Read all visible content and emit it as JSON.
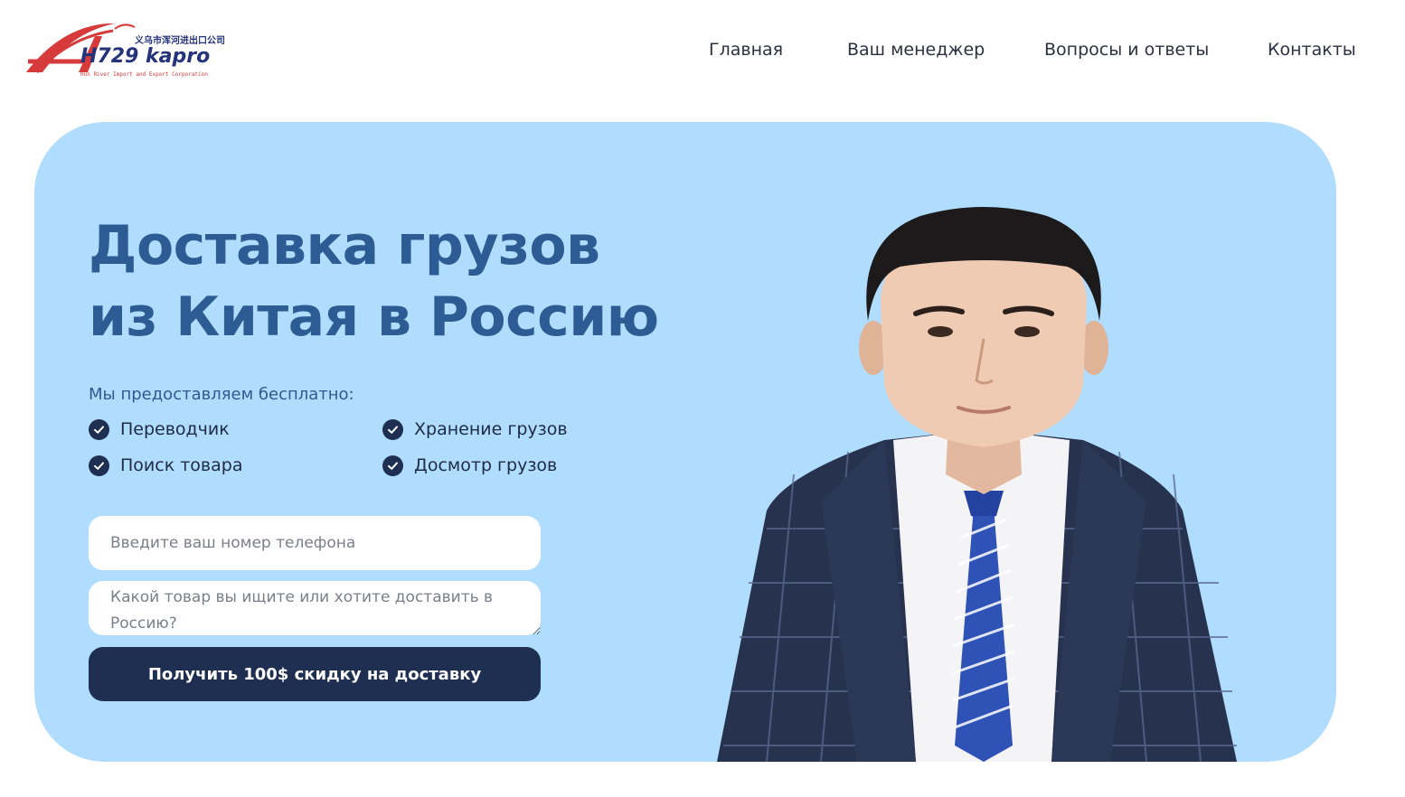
{
  "header": {
    "logo": {
      "brand": "H729 kapro",
      "chinese": "义乌市浑河进出口公司",
      "tagline": "Hun River Import and Export Corporation",
      "colors": {
        "red": "#d63a3a",
        "navy": "#24337a"
      }
    },
    "nav": [
      {
        "label": "Главная"
      },
      {
        "label": "Ваш менеджер"
      },
      {
        "label": "Вопросы и ответы"
      },
      {
        "label": "Контакты"
      }
    ]
  },
  "hero": {
    "title_line1": "Доставка грузов",
    "title_line2": "из Китая в Россию",
    "subtitle": "Мы предоставляем бесплатно:",
    "features": [
      {
        "label": "Переводчик",
        "icon": "check-circle-icon"
      },
      {
        "label": "Хранение грузов",
        "icon": "check-circle-icon"
      },
      {
        "label": "Поиск товара",
        "icon": "check-circle-icon"
      },
      {
        "label": "Досмотр грузов",
        "icon": "check-circle-icon"
      }
    ],
    "form": {
      "phone_placeholder": "Введите ваш номер телефона",
      "product_placeholder": "Какой товар вы ищите или хотите доставить в Россию?",
      "submit_label": "Получить 100$ скидку на доставку"
    },
    "colors": {
      "background": "#b0dcfd",
      "title": "#2d5b93",
      "button": "#1f2f52"
    }
  }
}
